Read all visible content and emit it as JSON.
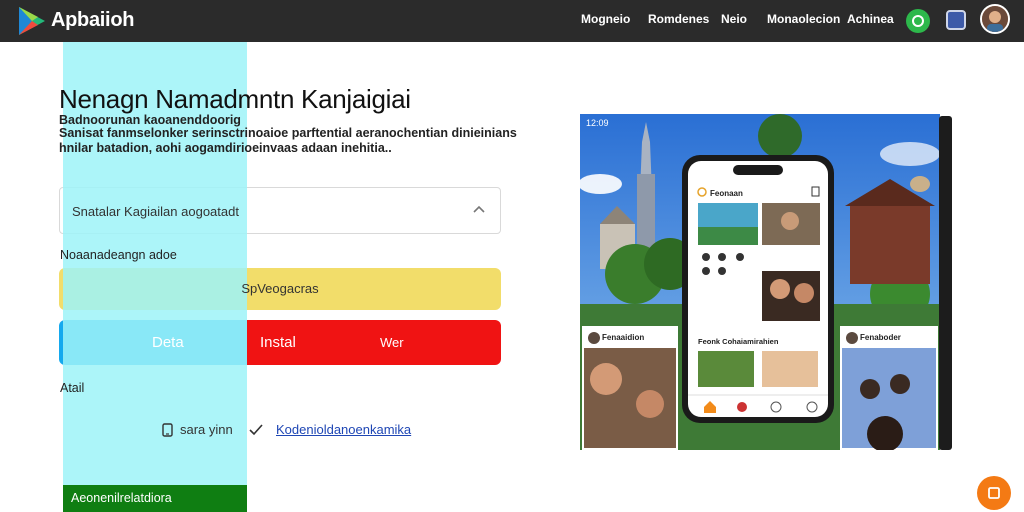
{
  "header": {
    "brand": "Apbaiioh",
    "nav": [
      "Mogneio",
      "Romdenes",
      "Neio",
      "Monaolecion",
      "Achinea"
    ],
    "icons": [
      "chat-icon",
      "app-icon",
      "avatar"
    ]
  },
  "main": {
    "headline": "Nenagn Namadmntn Kanjaigiai",
    "sub_lines": [
      "Badnoorunan kaoanenddoorig",
      "Sanisat fanmselonker serinsctrinoaioe parftential aeranochentian dinieinians",
      "hnilar batadion, aohi aogamdirioeinvaas adaan inehitia.."
    ],
    "dropdown_value": "Snatalar Kagiailan aogoatadt",
    "section_label": "Noaanadeangn adoe",
    "primary_button": "SpVeogacras",
    "buttons": {
      "blue": "Deta",
      "red_left": "Instal",
      "red_right": "Wer"
    },
    "small_label": "Atail",
    "device_text": "sara yinn",
    "link_text": "Kodenioldanoenkamika",
    "footer_label": "Aeonenilrelatdiora"
  },
  "hero": {
    "status": "12:09",
    "phone_title": "Feonaan",
    "phone_card_title": "Feonk Cohaiamirahien",
    "card_left_title": "Fenaaidion",
    "card_right_title": "Fenaboder"
  },
  "colors": {
    "accent_yellow": "#f2dd6a",
    "accent_blue": "#15a9ee",
    "accent_red": "#f01313",
    "accent_green": "#0f7e12",
    "stripe": "#9df3f8",
    "fab": "#f47a14"
  }
}
